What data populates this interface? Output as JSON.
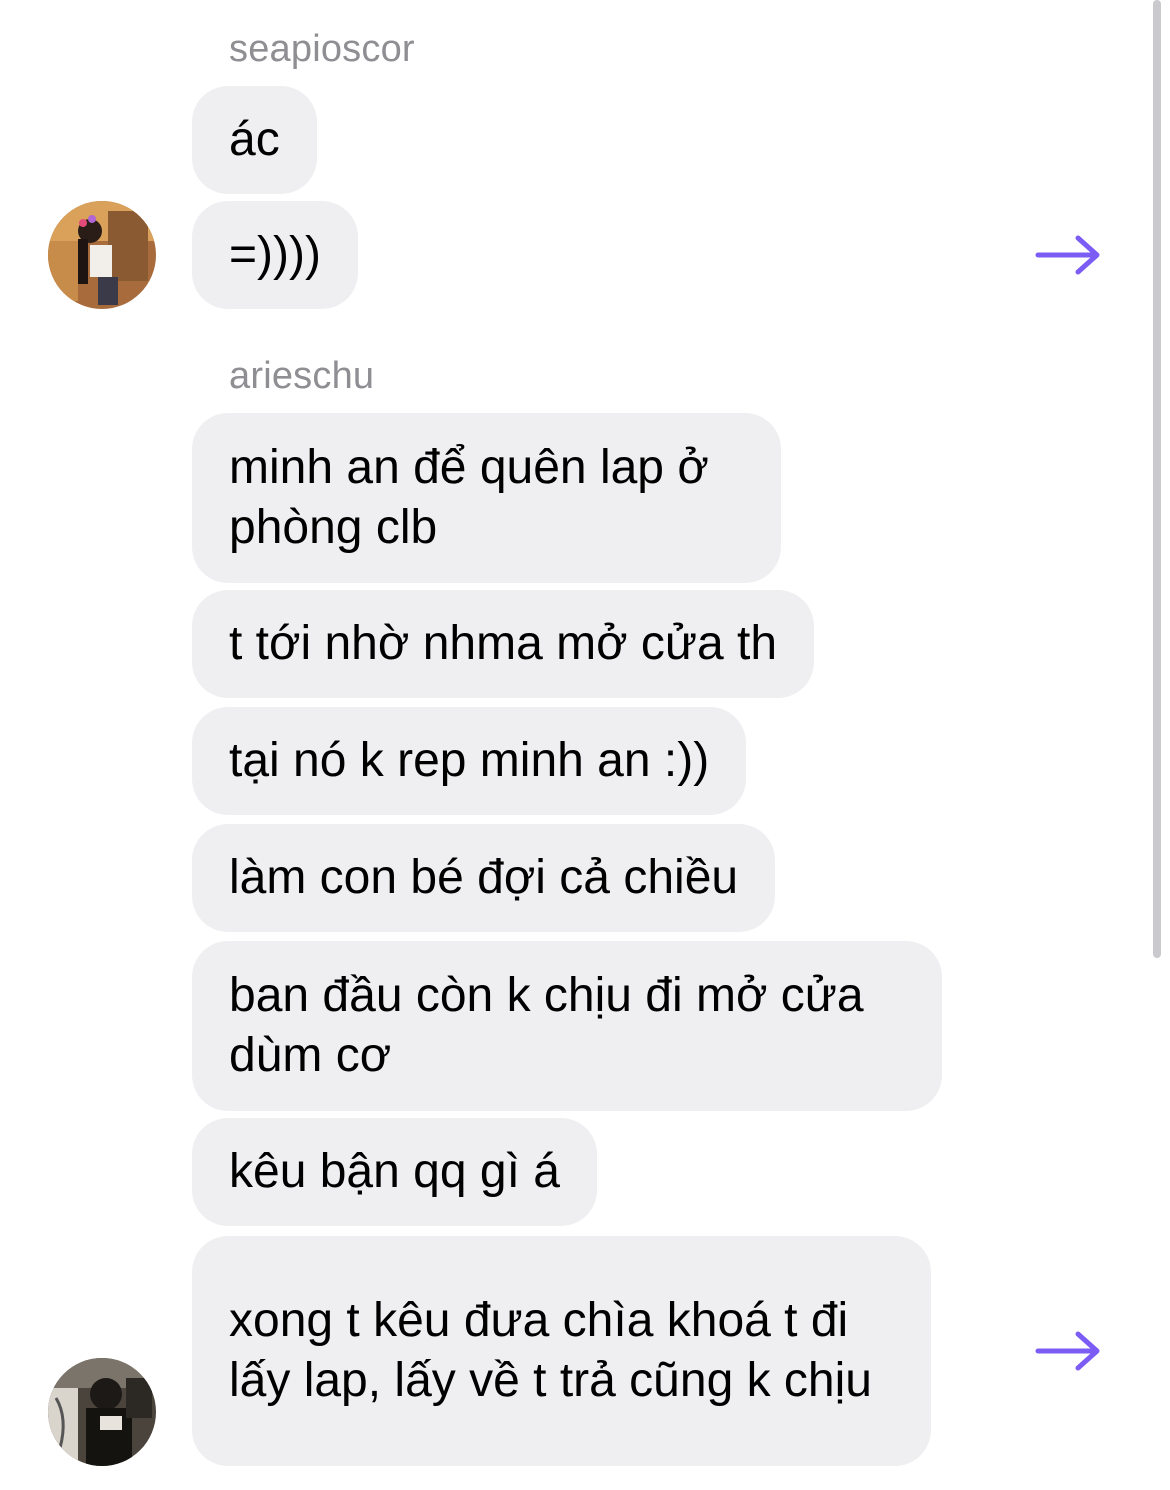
{
  "conversation": {
    "groups": [
      {
        "sender": "seapioscor",
        "messages": [
          "ác",
          "=))))"
        ]
      },
      {
        "sender": "arieschu",
        "messages": [
          "minh an để quên lap ở phòng clb",
          "t tới nhờ nhma mở cửa th",
          "tại nó k rep minh an :))",
          "làm con bé đợi cả chiều",
          "ban đầu còn k chịu đi mở cửa dùm cơ",
          "kêu bận qq gì á",
          "xong t kêu đưa chìa khoá t đi lấy lap, lấy về t trả cũng k chịu"
        ]
      }
    ]
  },
  "icons": {
    "share": "arrow-right-icon",
    "share_color": "#7b5cf5"
  },
  "colors": {
    "bubble": "#efeff1",
    "sender_name": "#8e8e93",
    "text": "#000000"
  }
}
